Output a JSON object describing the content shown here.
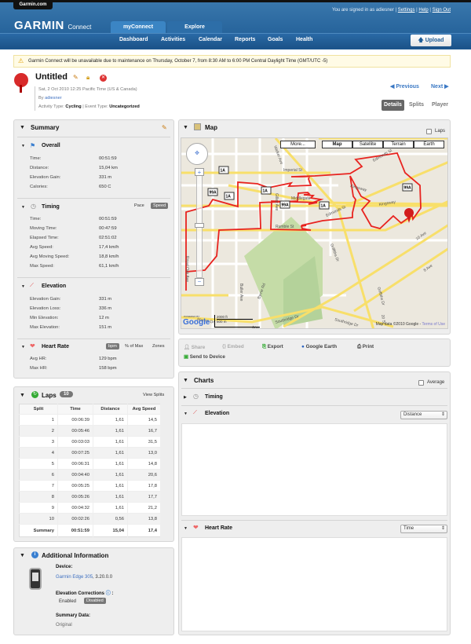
{
  "header": {
    "garmin_com": "Garmin.com",
    "logo": "GARMIN",
    "logo_sub": "Connect",
    "signed_in": "You are signed in as adiesner",
    "settings": "Settings",
    "help": "Help",
    "sign_out": "Sign Out",
    "tabs": [
      "myConnect",
      "Explore"
    ],
    "nav": [
      "Dashboard",
      "Activities",
      "Calendar",
      "Reports",
      "Goals",
      "Health"
    ],
    "upload": "Upload"
  },
  "alert": "Garmin Connect will be unavailable due to maintenance on Thursday, October 7, from 8:30 AM to 6:00 PM Central Daylight Time (GMT/UTC -5)",
  "activity": {
    "title": "Untitled",
    "date": "Sat, 2 Oct 2010 12:25 Pacific Time (US & Canada)",
    "by": "By",
    "user": "adiesner",
    "activity_type_label": "Activity Type:",
    "activity_type": "Cycling",
    "event_type_label": "| Event Type:",
    "event_type": "Uncategorized",
    "previous": "Previous",
    "next": "Next",
    "views": [
      "Details",
      "Splits",
      "Player"
    ]
  },
  "summary": {
    "title": "Summary",
    "overall": {
      "title": "Overall",
      "rows": [
        [
          "Time:",
          "00:51:59"
        ],
        [
          "Distance:",
          "15,04 km"
        ],
        [
          "Elevation Gain:",
          "331 m"
        ],
        [
          "Calories:",
          "650 C"
        ]
      ]
    },
    "timing": {
      "title": "Timing",
      "toggles": [
        "Pace",
        "Speed"
      ],
      "rows": [
        [
          "Time:",
          "00:51:59"
        ],
        [
          "Moving Time:",
          "00:47:59"
        ],
        [
          "Elapsed Time:",
          "02:51:02"
        ],
        [
          "Avg Speed:",
          "17,4 km/h"
        ],
        [
          "Avg Moving Speed:",
          "18,8 km/h"
        ],
        [
          "Max Speed:",
          "61,1 km/h"
        ]
      ]
    },
    "elevation": {
      "title": "Elevation",
      "rows": [
        [
          "Elevation Gain:",
          "331 m"
        ],
        [
          "Elevation Loss:",
          "336 m"
        ],
        [
          "Min Elevation:",
          "12 m"
        ],
        [
          "Max Elevation:",
          "151 m"
        ]
      ]
    },
    "heart_rate": {
      "title": "Heart Rate",
      "toggles": [
        "bpm",
        "% of Max",
        "Zones"
      ],
      "rows": [
        [
          "Avg HR:",
          "129 bpm"
        ],
        [
          "Max HR:",
          "158 bpm"
        ]
      ]
    }
  },
  "laps": {
    "title": "Laps",
    "count": "10",
    "view_splits": "View Splits",
    "columns": [
      "Split",
      "Time",
      "Distance",
      "Avg Speed"
    ],
    "rows": [
      [
        "1",
        "00:06:39",
        "1,61",
        "14,5"
      ],
      [
        "2",
        "00:05:46",
        "1,61",
        "16,7"
      ],
      [
        "3",
        "00:03:03",
        "1,61",
        "31,5"
      ],
      [
        "4",
        "00:07:25",
        "1,61",
        "13,0"
      ],
      [
        "5",
        "00:06:31",
        "1,61",
        "14,8"
      ],
      [
        "6",
        "00:04:40",
        "1,61",
        "20,6"
      ],
      [
        "7",
        "00:05:25",
        "1,61",
        "17,8"
      ],
      [
        "8",
        "00:05:26",
        "1,61",
        "17,7"
      ],
      [
        "9",
        "00:04:32",
        "1,61",
        "21,2"
      ],
      [
        "10",
        "00:02:26",
        "0,56",
        "13,8"
      ]
    ],
    "summary": [
      "Summary",
      "00:51:59",
      "15,04",
      "17,4"
    ]
  },
  "additional": {
    "title": "Additional Information",
    "device_label": "Device:",
    "device": "Garmin Edge 305",
    "device_version": ", 3.20.0.0",
    "elev_corr_label": "Elevation Corrections",
    "elev_options": [
      "Enabled",
      "Disabled"
    ],
    "summary_data_label": "Summary Data:",
    "summary_data": "Original"
  },
  "map": {
    "title": "Map",
    "laps": "Laps",
    "buttons": [
      "More...",
      "Map",
      "Satellite",
      "Terrain",
      "Earth"
    ],
    "labels": [
      "Imperial St",
      "Middlegate",
      "Kingsway",
      "Kingsway",
      "Rumble St",
      "Edmonds St",
      "Edmonds St",
      "Griffiths Dr",
      "Griffiths Dr",
      "Royal Oak Ave",
      "Marine Dr",
      "Marine Dr",
      "Southridge Dr",
      "Southridge Dr",
      "10 Ave",
      "8 Ave",
      "Walker Ave",
      "Gilley Ave",
      "Buller Ave",
      "Byrne Rd",
      "20 St"
    ],
    "shields": [
      "1A",
      "99A",
      "1A",
      "1A",
      "99A",
      "1A",
      "99A"
    ],
    "scale_ft": "2000 ft",
    "scale_m": "500 m",
    "powered": "POWERED BY",
    "google": "Google",
    "attribution": "Map data ©2010 Google -",
    "terms": "Terms of Use"
  },
  "actions": [
    "Share",
    "Embed",
    "Export",
    "Google Earth",
    "Print",
    "Send to Device"
  ],
  "charts": {
    "title": "Charts",
    "average": "Average",
    "timing": "Timing",
    "elevation": "Elevation",
    "elevation_axis": "Distance",
    "heart_rate": "Heart Rate",
    "hr_axis": "Time"
  }
}
